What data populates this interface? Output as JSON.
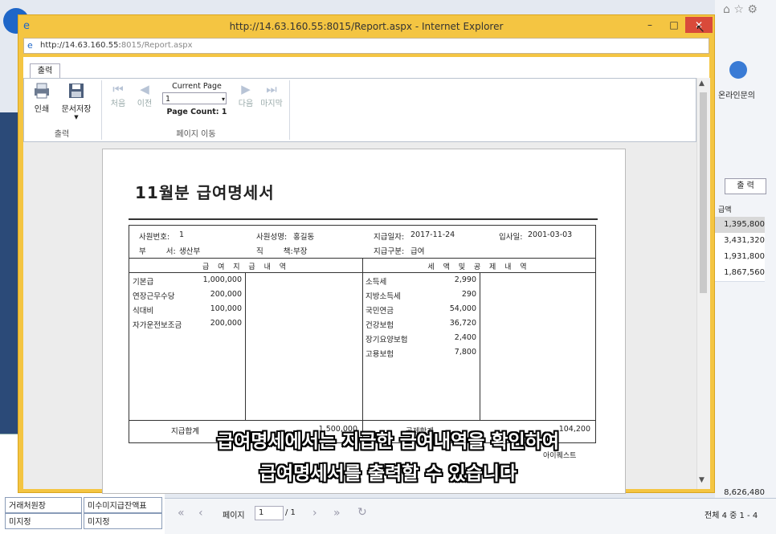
{
  "background_app": {
    "right_labels": {
      "online_inquiry": "온라인문의",
      "print_button": "출 력",
      "amount_header": "급액"
    },
    "amounts": [
      "1,395,800",
      "3,431,320",
      "1,931,800",
      "1,867,560"
    ],
    "total_amount": "8,626,480",
    "left_table": [
      [
        "거래처원장",
        "미수미지급잔액표"
      ],
      [
        "미지정",
        "미지정"
      ]
    ],
    "pager": {
      "page_label": "페이지",
      "page_value": "1",
      "page_total": "/ 1",
      "summary": "전체 4 중 1 - 4"
    }
  },
  "ie": {
    "title": "http://14.63.160.55:8015/Report.aspx - Internet Explorer",
    "address_host": "http://14.63.160.55:",
    "address_rest": "8015/Report.aspx",
    "tab": "출력",
    "ribbon": {
      "print": "인쇄",
      "save": "문서저장",
      "group_output": "출력",
      "first": "처음",
      "prev": "이전",
      "current_page_label": "Current Page",
      "current_page_value": "1",
      "page_count": "Page Count: 1",
      "next": "다음",
      "last": "마지막",
      "group_nav": "페이지 이동"
    }
  },
  "report": {
    "title": "11월분 급여명세서",
    "employee_no_label": "사원번호:",
    "employee_no": "1",
    "employee_name_label": "사원성명:",
    "employee_name": "홍길동",
    "pay_date_label": "지급일자:",
    "pay_date": "2017-11-24",
    "hire_date_label": "입사일:",
    "hire_date": "2001-03-03",
    "dept_label": "부 서:",
    "dept": "생산부",
    "position_label": "직 책:",
    "position": "부장",
    "pay_type_label": "지급구분:",
    "pay_type": "급여",
    "earnings_header": "급 여 지 급 내 역",
    "deductions_header": "세 액 및 공 제 내 역",
    "earnings": [
      {
        "name": "기본급",
        "amount": "1,000,000"
      },
      {
        "name": "연장근무수당",
        "amount": "200,000"
      },
      {
        "name": "식대비",
        "amount": "100,000"
      },
      {
        "name": "자가운전보조금",
        "amount": "200,000"
      }
    ],
    "deductions": [
      {
        "name": "소득세",
        "amount": "2,990"
      },
      {
        "name": "지방소득세",
        "amount": "290"
      },
      {
        "name": "국민연금",
        "amount": "54,000"
      },
      {
        "name": "건강보험",
        "amount": "36,720"
      },
      {
        "name": "장기요양보험",
        "amount": "2,400"
      },
      {
        "name": "고용보험",
        "amount": "7,800"
      }
    ],
    "total_pay_label": "지급합계",
    "total_pay": "1,500,000",
    "total_deduction_label": "공제합계",
    "total_deduction": "104,200",
    "company": "아이퀘스트"
  },
  "subtitle": {
    "line1": "급여명세에서는 지급한 급여내역을 확인하여",
    "line2": "급여명세서를 출력할 수 있습니다"
  }
}
